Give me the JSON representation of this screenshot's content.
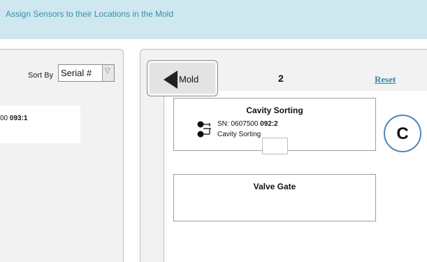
{
  "banner": {
    "title": "Assign Sensors to their Locations in the Mold"
  },
  "left_panel": {
    "sort_label": "Sort By",
    "sort_select": {
      "value": "Serial #",
      "arrow": "▽"
    },
    "sensor_list": [
      {
        "serial_prefix": "00 ",
        "serial_suffix": "093:1"
      }
    ]
  },
  "right_panel": {
    "mold_button_label": "Mold",
    "mold_number": "2",
    "reset_label": "Reset",
    "locations": [
      {
        "title": "Cavity Sorting",
        "sensor": {
          "sn_prefix": "SN: 0607500 ",
          "sn_suffix": "092:2",
          "field_label": "Cavity Sorting",
          "field_value": ""
        }
      },
      {
        "title": "Valve Gate"
      }
    ]
  },
  "callout": {
    "label": "C"
  },
  "colors": {
    "banner_bg": "#cfe7ef",
    "banner_text": "#3b8fa8",
    "link": "#2f8aa8",
    "callout_border": "#4d87b8"
  }
}
